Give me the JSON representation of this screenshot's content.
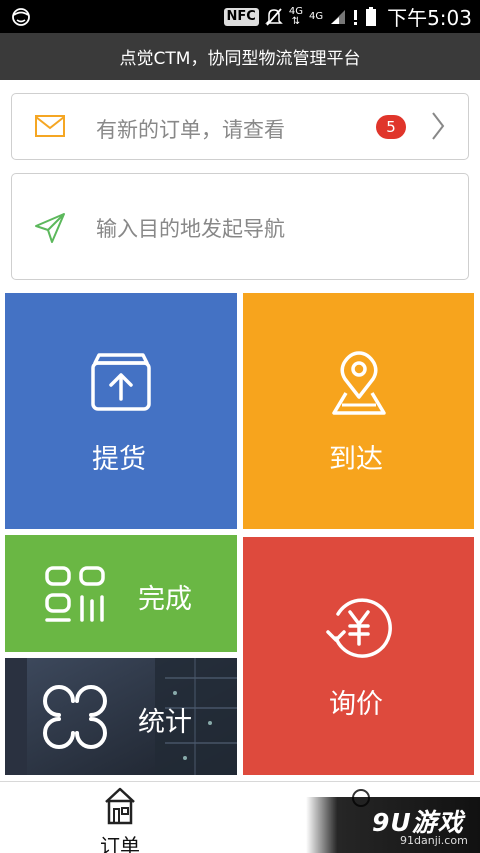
{
  "status_bar": {
    "nfc": "NFC",
    "network_1": "4G",
    "network_2": "4G",
    "time": "下午5:03"
  },
  "header": {
    "title": "点觉CTM，协同型物流管理平台"
  },
  "order_card": {
    "text": "有新的订单，请查看",
    "badge_count": "5",
    "icon": "mail-icon",
    "icon_color": "#f5a623"
  },
  "nav_card": {
    "text": "输入目的地发起导航",
    "icon": "navigation-arrow-icon",
    "icon_color": "#5cb85c"
  },
  "tiles": {
    "pickup": {
      "label": "提货",
      "icon": "upload-box-icon",
      "color": "#4472c4"
    },
    "arrive": {
      "label": "到达",
      "icon": "map-pin-icon",
      "color": "#f7a41d"
    },
    "done": {
      "label": "完成",
      "icon": "qr-code-icon",
      "color": "#6ab744"
    },
    "stats": {
      "label": "统计",
      "icon": "infinity-loops-icon",
      "color": "#2c3442"
    },
    "inquiry": {
      "label": "询价",
      "icon": "yen-refresh-icon",
      "color": "#de4a3d"
    }
  },
  "bottom_nav": {
    "orders_label": "订单",
    "orders_icon": "house-icon"
  },
  "watermark": {
    "logo": "9U游戏",
    "url": "91danji.com"
  }
}
